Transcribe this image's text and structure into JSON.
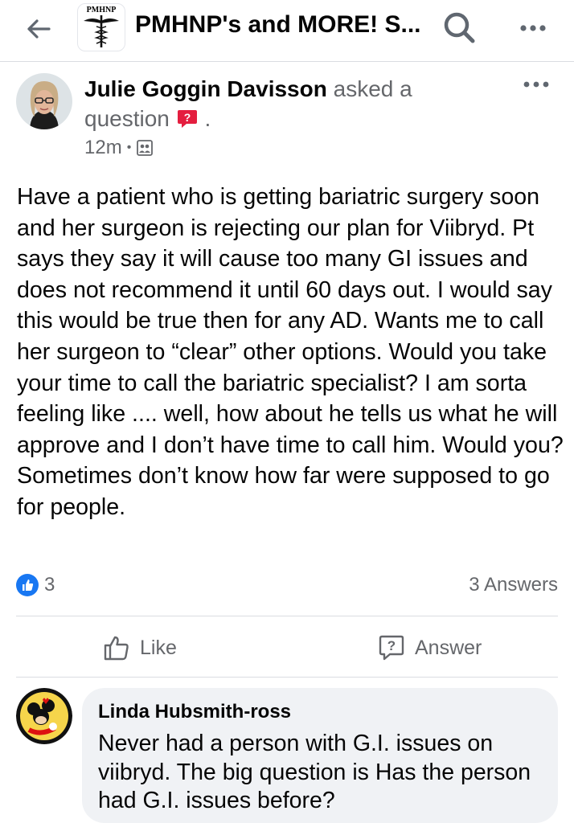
{
  "header": {
    "logo_text": "PMHNP",
    "group_title": "PMHNP's and MORE! S...",
    "icons": [
      "back-arrow-icon",
      "caduceus-logo",
      "search-icon",
      "more-horizontal-icon"
    ]
  },
  "post": {
    "author_name": "Julie Goggin Davisson",
    "action_text": "asked a question",
    "action_suffix": ".",
    "time": "12m",
    "separator": "•",
    "audience_icon": "group-audience-icon",
    "body": "Have a patient who is getting bariatric surgery soon and her surgeon is rejecting our plan for Viibryd. Pt says they say it will cause too many GI issues and does not recommend it until 60 days out. I would say this would be true then for any AD. Wants me to call her surgeon to “clear” other options. Would you take your time to call the bariatric specialist? I am sorta feeling like .... well, how about he tells us what he will approve and I don’t have time to call him. Would you? Sometimes don’t know how far were supposed to go for people.",
    "reaction_count": "3",
    "answers_count": "3 Answers"
  },
  "actions": {
    "like_label": "Like",
    "answer_label": "Answer"
  },
  "comment": {
    "author": "Linda Hubsmith-ross",
    "text": "Never had a person with G.I. issues on viibryd.  The big question is  Has the person had G.I. issues before?"
  },
  "colors": {
    "accent_blue": "#1877f2",
    "question_badge_red": "#e41e3f",
    "secondary_text": "#65676b",
    "primary_text": "#050505",
    "comment_bg": "#f0f2f5"
  }
}
